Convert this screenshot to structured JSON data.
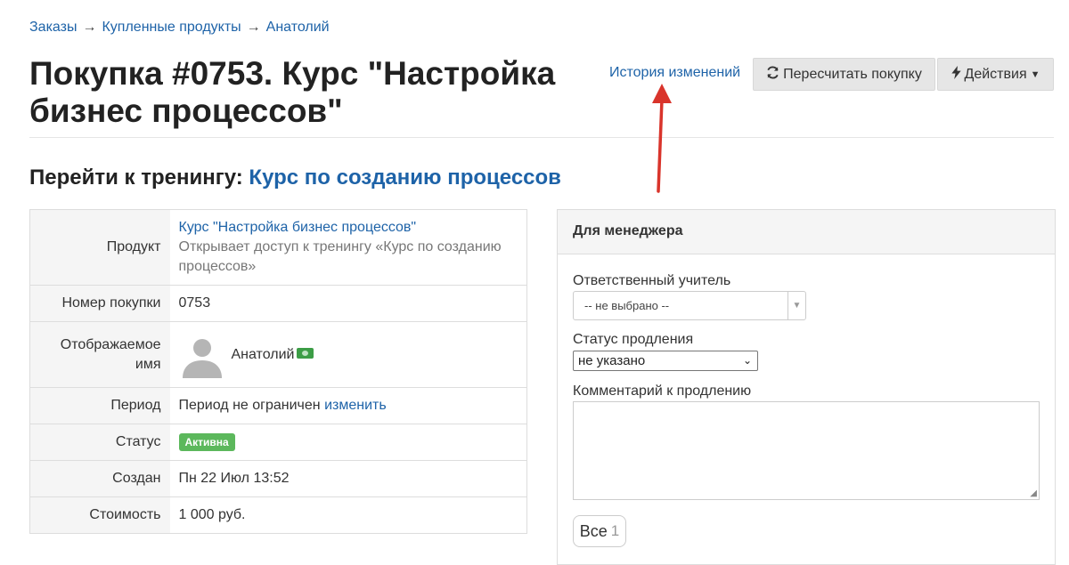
{
  "breadcrumb": {
    "items": [
      "Заказы",
      "Купленные продукты",
      "Анатолий"
    ],
    "separator": "→"
  },
  "title": "Покупка #0753. Курс \"Настройка бизнес процессов\"",
  "header_actions": {
    "history_link": "История изменений",
    "recalc_button": "Пересчитать покупку",
    "actions_button": "Действия"
  },
  "training": {
    "prefix": "Перейти к тренингу:",
    "link": "Курс по созданию процессов"
  },
  "info": {
    "product_label": "Продукт",
    "product_link": "Курс \"Настройка бизнес процессов\"",
    "product_desc": "Открывает доступ к тренингу «Курс по созданию процессов»",
    "number_label": "Номер покупки",
    "number_value": "0753",
    "name_label": "Отображаемое имя",
    "name_value": "Анатолий",
    "period_label": "Период",
    "period_value": "Период не ограничен",
    "period_change": "изменить",
    "status_label": "Статус",
    "status_badge": "Активна",
    "created_label": "Создан",
    "created_value": "Пн 22 Июл 13:52",
    "price_label": "Стоимость",
    "price_value": "1 000 руб."
  },
  "manager_panel": {
    "title": "Для менеджера",
    "teacher_label": "Ответственный учитель",
    "teacher_value": "-- не выбрано --",
    "renewal_label": "Статус продления",
    "renewal_value": "не указано",
    "comment_label": "Комментарий к продлению",
    "comment_value": "",
    "all_button": "Все",
    "all_count": "1"
  },
  "colors": {
    "link": "#1e63a8",
    "badge_active": "#5cb85c",
    "annotation_arrow": "#d9342b",
    "button_bg": "#e6e6e6"
  },
  "icons": [
    "refresh-icon",
    "bolt-icon",
    "caret-down-icon",
    "cash-icon",
    "avatar-placeholder-icon",
    "annotation-arrow"
  ]
}
